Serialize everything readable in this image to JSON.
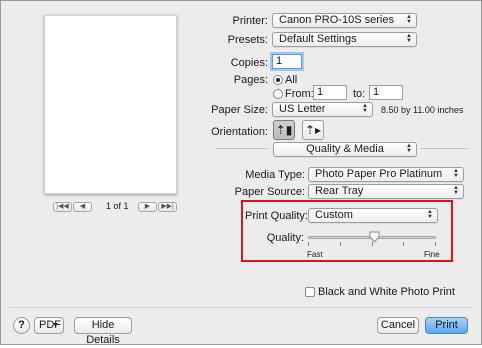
{
  "printer": {
    "label": "Printer:",
    "value": "Canon PRO-10S series"
  },
  "presets": {
    "label": "Presets:",
    "value": "Default Settings"
  },
  "copies": {
    "label": "Copies:",
    "value": "1"
  },
  "pages": {
    "label": "Pages:",
    "all": "All",
    "from": "From:",
    "from_value": "1",
    "to": "to:",
    "to_value": "1",
    "selected": "All"
  },
  "paper_size": {
    "label": "Paper Size:",
    "value": "US Letter",
    "dimensions": "8.50 by 11.00 inches"
  },
  "orientation": {
    "label": "Orientation:",
    "selected": "portrait"
  },
  "panel": {
    "value": "Quality & Media"
  },
  "media_type": {
    "label": "Media Type:",
    "value": "Photo Paper Pro Platinum"
  },
  "paper_source": {
    "label": "Paper Source:",
    "value": "Rear Tray"
  },
  "print_quality": {
    "label": "Print Quality:",
    "value": "Custom"
  },
  "quality": {
    "label": "Quality:",
    "min_label": "Fast",
    "max_label": "Fine",
    "level_fraction": 0.5,
    "ticks": 5
  },
  "preview_nav": {
    "page_info": "1 of 1"
  },
  "bw_photo": {
    "label": "Black and White Photo Print",
    "checked": false
  },
  "footer": {
    "help": "?",
    "pdf": "PDF",
    "hide_details": "Hide Details",
    "cancel": "Cancel",
    "print": "Print"
  },
  "colors": {
    "highlight": "#e0141d",
    "default_button": "#5ea8ef"
  }
}
